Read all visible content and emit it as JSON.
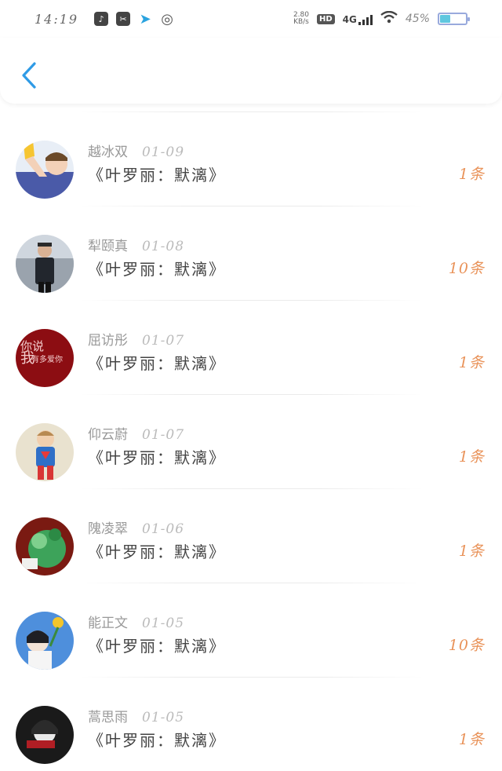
{
  "status_bar": {
    "time": "14:19",
    "net_speed_value": "2.80",
    "net_speed_unit": "KB/s",
    "hd": "HD",
    "network": "4G",
    "battery": "45%",
    "battery_level": 0.45
  },
  "header": {
    "back_icon": "chevron-left-icon",
    "accent": "#2f9be6"
  },
  "items": [
    {
      "name": "越冰双",
      "date": "01-09",
      "title": "《叶罗丽：默漓》",
      "count": "1条"
    },
    {
      "name": "犁颐真",
      "date": "01-08",
      "title": "《叶罗丽：默漓》",
      "count": "10条"
    },
    {
      "name": "屈访彤",
      "date": "01-07",
      "title": "《叶罗丽：默漓》",
      "count": "1条"
    },
    {
      "name": "仰云蔚",
      "date": "01-07",
      "title": "《叶罗丽：默漓》",
      "count": "1条"
    },
    {
      "name": "隗凌翠",
      "date": "01-06",
      "title": "《叶罗丽：默漓》",
      "count": "1条"
    },
    {
      "name": "能正文",
      "date": "01-05",
      "title": "《叶罗丽：默漓》",
      "count": "10条"
    },
    {
      "name": "蒿思雨",
      "date": "01-05",
      "title": "《叶罗丽：默漓》",
      "count": "1条"
    }
  ],
  "avatar_text": {
    "line1": "你说",
    "line2": "我",
    "line3": "有多爱你"
  },
  "colors": {
    "count": "#e9935a",
    "name": "#999999",
    "title": "#444444"
  }
}
